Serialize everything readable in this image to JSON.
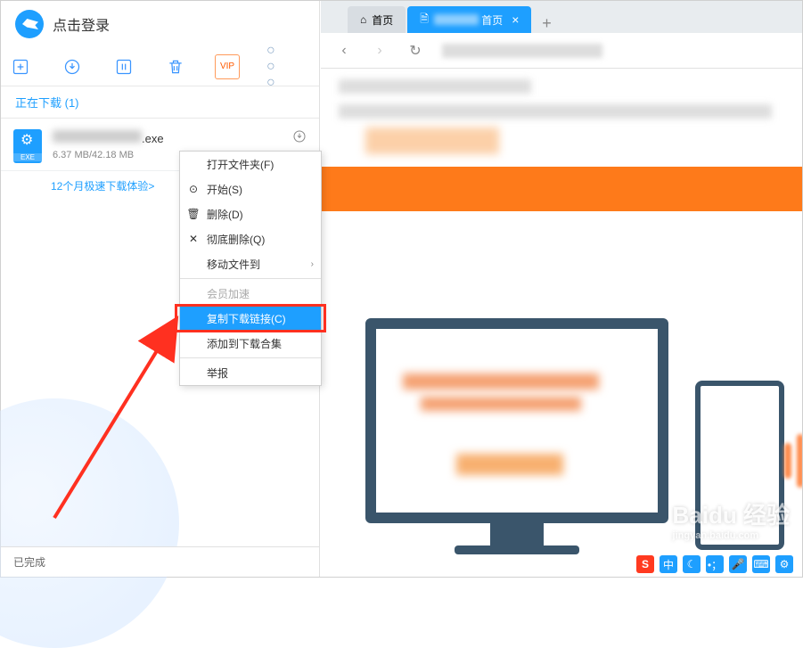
{
  "header": {
    "login_text": "点击登录"
  },
  "toolbar": {
    "vip_label": "VIP"
  },
  "tabs": {
    "downloading_label": "正在下载 (1)"
  },
  "download_item": {
    "filename_suffix": ".exe",
    "size_text": "6.37 MB/42.18 MB"
  },
  "promo": {
    "text": "12个月极速下载体验>"
  },
  "context_menu": {
    "open_folder": "打开文件夹(F)",
    "start": "开始(S)",
    "delete": "删除(D)",
    "delete_full": "彻底删除(Q)",
    "move_to": "移动文件到",
    "vip_accel": "会员加速",
    "copy_link": "复制下载链接(C)",
    "add_collection": "添加到下载合集",
    "report": "举报"
  },
  "footer": {
    "completed": "已完成"
  },
  "browser": {
    "tab_home": "首页",
    "tab_active": "首页",
    "new_tab": "+"
  },
  "watermark": {
    "brand": "Baidu 经验",
    "url": "jingyan.baidu.com"
  }
}
